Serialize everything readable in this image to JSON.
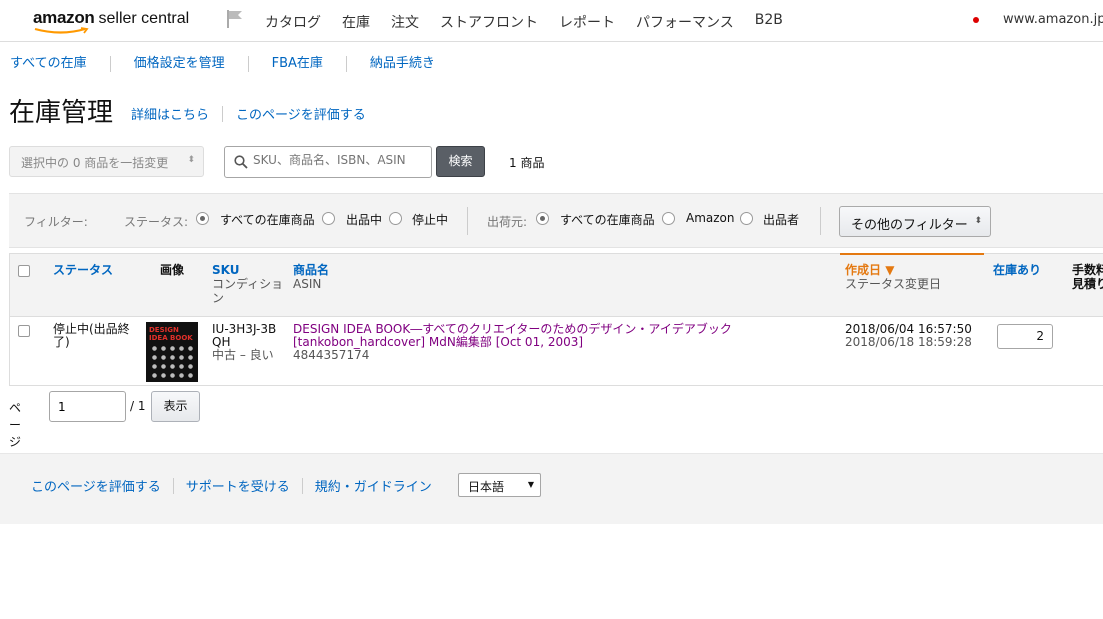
{
  "brand": {
    "name": "amazon",
    "product": "seller central"
  },
  "nav": [
    "カタログ",
    "在庫",
    "注文",
    "ストアフロント",
    "レポート",
    "パフォーマンス",
    "B2B"
  ],
  "marketplace": "www.amazon.jp",
  "subnav": [
    "すべての在庫",
    "価格設定を管理",
    "FBA在庫",
    "納品手続き"
  ],
  "page": {
    "title": "在庫管理",
    "learn_more": "詳細はこちら",
    "rate_page": "このページを評価する"
  },
  "actions": {
    "bulk": "選択中の 0 商品を一括変更",
    "search_placeholder": "SKU、商品名、ISBN、ASIN",
    "search_button": "検索",
    "count": "1 商品"
  },
  "filters": {
    "label": "フィルター:",
    "status_label": "ステータス:",
    "status_options": [
      "すべての在庫商品",
      "出品中",
      "停止中"
    ],
    "status_selected": "すべての在庫商品",
    "fulfillment_label": "出荷元:",
    "fulfillment_options": [
      "すべての在庫商品",
      "Amazon",
      "出品者"
    ],
    "fulfillment_selected": "すべての在庫商品",
    "more": "その他のフィルター"
  },
  "table": {
    "headers": {
      "status": "ステータス",
      "image": "画像",
      "sku": "SKU",
      "condition": "コンディション",
      "name": "商品名",
      "asin": "ASIN",
      "created": "作成日",
      "status_changed": "ステータス変更日",
      "inventory": "在庫あり",
      "fee": "手数料見積り"
    },
    "rows": [
      {
        "status": "停止中(出品終了)",
        "sku": "IU-3H3J-3BQH",
        "condition": "中古 – 良い",
        "title": "DESIGN IDEA BOOK―すべてのクリエイターのためのデザイン・アイデアブック [tankobon_hardcover] MdN編集部 [Oct 01, 2003]",
        "asin": "4844357174",
        "created": "2018/06/04 16:57:50",
        "status_changed": "2018/06/18 18:59:28",
        "quantity": "2",
        "thumb_text": "DESIGN IDEA BOOK"
      }
    ]
  },
  "pager": {
    "label": "ページ",
    "value": "1",
    "of": "/ 1",
    "button": "表示"
  },
  "footer": {
    "rate": "このページを評価する",
    "support": "サポートを受ける",
    "policies": "規約・ガイドライン",
    "language": "日本語"
  }
}
